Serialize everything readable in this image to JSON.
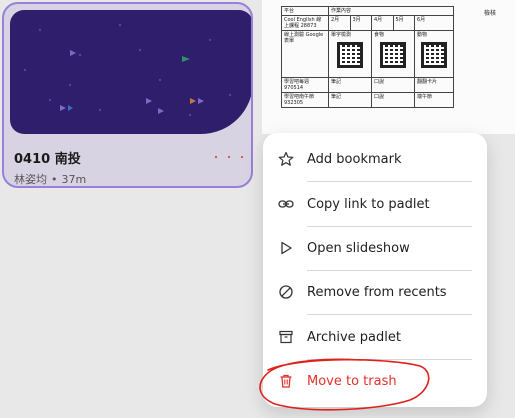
{
  "card": {
    "title": "0410 南投",
    "author": "林姿均",
    "separator": "•",
    "time": "37m"
  },
  "doc_preview": {
    "header": [
      "平台",
      "作業內容",
      "",
      "",
      "",
      "",
      "",
      "檢核"
    ],
    "row1": {
      "label": "Cool English 線上課程 28873",
      "cells": [
        "2月",
        "3月",
        "4月",
        "5月",
        "6月"
      ]
    },
    "row2": {
      "label": "線上測驗 Google 表單",
      "cells": [
        "單字檢測",
        "食物",
        "動物"
      ]
    },
    "row3": {
      "label": "學習吧每週 970514",
      "cells": [
        "筆記",
        "口說",
        "翻翻卡片"
      ]
    },
    "row4": {
      "label": "學習吧南午節 932305",
      "cells": [
        "筆記",
        "口說",
        "端午節"
      ]
    }
  },
  "menu": {
    "items": [
      {
        "label": "Add bookmark",
        "icon": "star-icon"
      },
      {
        "label": "Copy link to padlet",
        "icon": "link-icon"
      },
      {
        "label": "Open slideshow",
        "icon": "play-icon"
      },
      {
        "label": "Remove from recents",
        "icon": "remove-circle-icon"
      },
      {
        "label": "Archive padlet",
        "icon": "archive-icon"
      },
      {
        "label": "Move to trash",
        "icon": "trash-icon"
      }
    ]
  },
  "colors": {
    "accent_border": "#9a7fd8",
    "thumb_bg": "#2e1e6c",
    "danger": "#e0322b",
    "annotation": "#e0201c"
  }
}
